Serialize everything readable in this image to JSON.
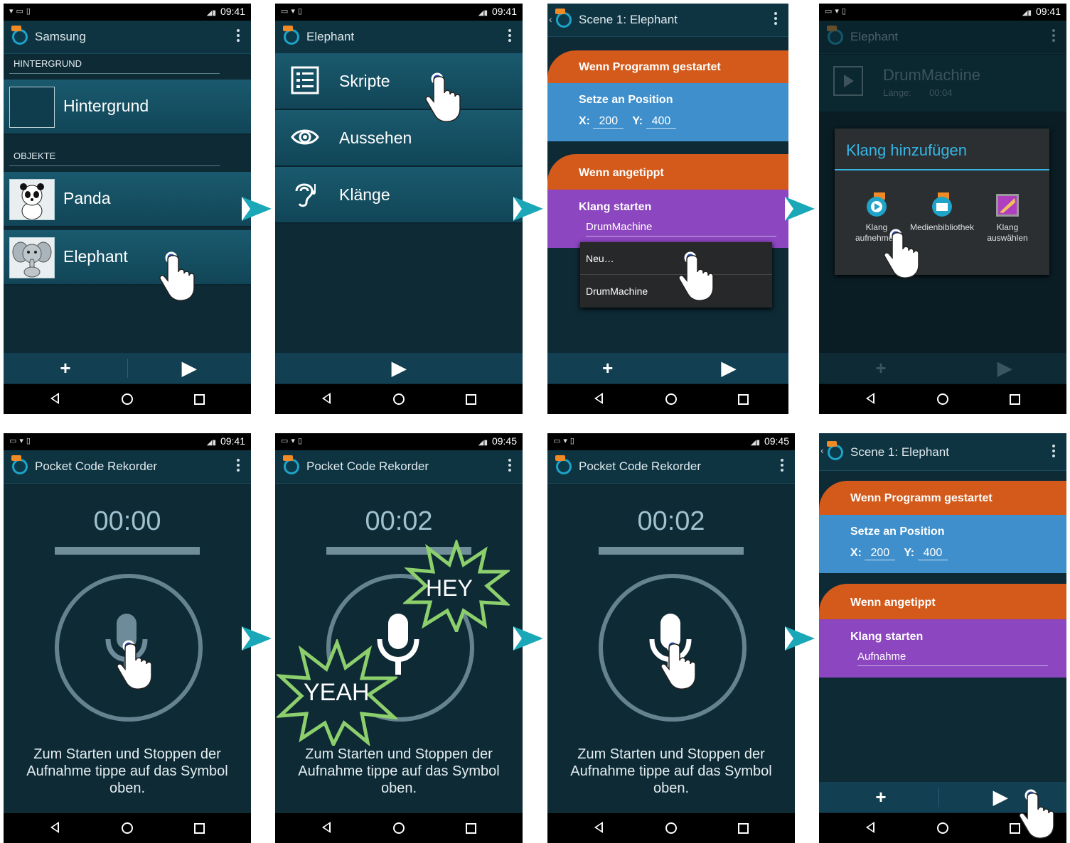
{
  "status": {
    "time_a": "09:41",
    "time_b": "09:45"
  },
  "screen1": {
    "title": "Samsung",
    "section_background": "HINTERGRUND",
    "background_item": "Hintergrund",
    "section_objects": "OBJEKTE",
    "objects": [
      "Panda",
      "Elephant"
    ]
  },
  "screen2": {
    "title": "Elephant",
    "menu": [
      "Skripte",
      "Aussehen",
      "Klänge"
    ]
  },
  "screen3": {
    "title": "Scene 1: Elephant",
    "brick_start": "Wenn Programm gestartet",
    "brick_position": "Setze an Position",
    "x_label": "X:",
    "x_value": "200",
    "y_label": "Y:",
    "y_value": "400",
    "brick_tapped": "Wenn angetippt",
    "brick_sound": "Klang starten",
    "sound_value": "DrumMachine",
    "dropdown_options": [
      "Neu…",
      "DrumMachine"
    ]
  },
  "screen4": {
    "title": "Elephant",
    "sound_name": "DrumMachine",
    "length_label": "Länge:",
    "length_value": "00:04",
    "dialog_title": "Klang hinzufügen",
    "options": [
      "Klang aufnehmen",
      "Medienbibliothek",
      "Klang auswählen"
    ]
  },
  "recorder": {
    "title": "Pocket Code Rekorder",
    "time_idle": "00:00",
    "time_recording": "00:02",
    "hint": "Zum Starten und Stoppen der Aufnahme tippe auf das Symbol oben.",
    "burst_hey": "HEY",
    "burst_yeah": "YEAH"
  },
  "screen8": {
    "title": "Scene 1: Elephant",
    "sound_value": "Aufnahme"
  },
  "colors": {
    "accent": "#35b6e5",
    "arrow": "#1aa8b8",
    "brick_orange": "#d35a1a",
    "brick_blue": "#3e8fcc",
    "brick_purple": "#8c46c0"
  },
  "icons": [
    "catrobat-logo-icon",
    "overflow-menu-icon",
    "plus-icon",
    "play-icon",
    "back-icon",
    "home-icon",
    "recent-apps-icon",
    "microphone-icon",
    "script-icon",
    "eye-icon",
    "ear-icon",
    "pointing-hand-icon",
    "next-arrow-icon"
  ]
}
